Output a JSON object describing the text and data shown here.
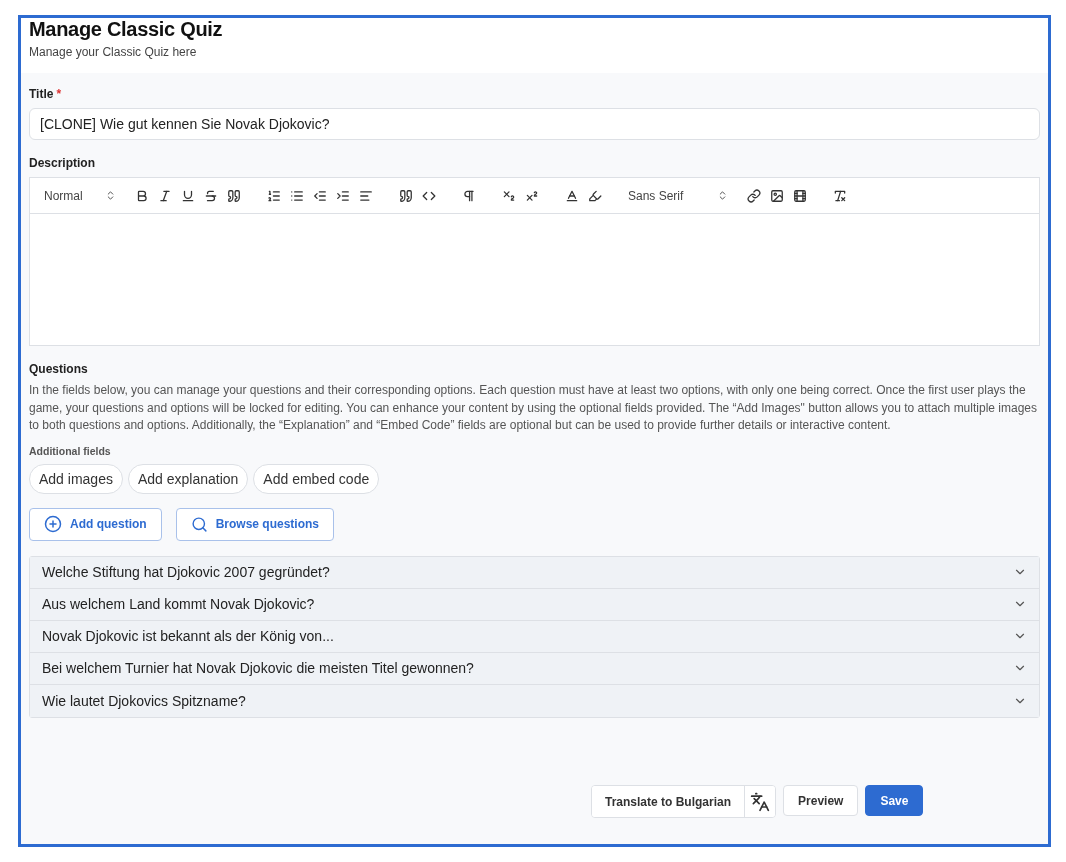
{
  "header": {
    "title": "Manage Classic Quiz",
    "subtitle": "Manage your Classic Quiz here"
  },
  "title_field": {
    "label": "Title",
    "required_mark": "*",
    "value": "[CLONE] Wie gut kennen Sie Novak Djokovic?"
  },
  "description": {
    "label": "Description",
    "toolbar": [
      {
        "kind": "select",
        "label": "Normal"
      },
      {
        "kind": "bold"
      },
      {
        "kind": "italic"
      },
      {
        "kind": "underline"
      },
      {
        "kind": "strike"
      },
      {
        "kind": "quote"
      },
      {
        "kind": "gap"
      },
      {
        "kind": "ordered"
      },
      {
        "kind": "bullet"
      },
      {
        "kind": "outdent"
      },
      {
        "kind": "indent"
      },
      {
        "kind": "align"
      },
      {
        "kind": "gap"
      },
      {
        "kind": "quote"
      },
      {
        "kind": "code"
      },
      {
        "kind": "gap"
      },
      {
        "kind": "pilcrow"
      },
      {
        "kind": "gap"
      },
      {
        "kind": "sub"
      },
      {
        "kind": "sup"
      },
      {
        "kind": "gap"
      },
      {
        "kind": "color"
      },
      {
        "kind": "background"
      },
      {
        "kind": "gap"
      },
      {
        "kind": "select",
        "label": "Sans Serif"
      },
      {
        "kind": "link"
      },
      {
        "kind": "image"
      },
      {
        "kind": "video"
      },
      {
        "kind": "gap"
      },
      {
        "kind": "clean"
      }
    ]
  },
  "questions": {
    "label": "Questions",
    "help": "In the fields below, you can manage your questions and their corresponding options. Each question must have at least two options, with only one being correct. Once the first user plays the game, your questions and options will be locked for editing. You can enhance your content by using the optional fields provided. The “Add Images\" button allows you to attach multiple images to both questions and options. Additionally, the “Explanation” and “Embed Code” fields are optional but can be used to provide further details or interactive content.",
    "additional_label": "Additional fields",
    "additional": [
      "Add images",
      "Add explanation",
      "Add embed code"
    ],
    "actions": [
      {
        "kind": "add",
        "label": "Add question"
      },
      {
        "kind": "browse",
        "label": "Browse questions"
      }
    ],
    "items": [
      {
        "text": "Welche Stiftung hat Djokovic 2007 gegründet?",
        "expanded": false
      },
      {
        "text": "Aus welchem Land kommt Novak Djokovic?",
        "expanded": false
      },
      {
        "text": "Novak Djokovic ist bekannt als der König von...",
        "expanded": false
      },
      {
        "text": "Bei welchem Turnier hat Novak Djokovic die meisten Titel gewonnen?",
        "expanded": false
      },
      {
        "text": "Wie lautet Djokovics Spitzname?",
        "expanded": false
      }
    ]
  },
  "footer": {
    "translate": "Translate to Bulgarian",
    "preview": "Preview",
    "save": "Save"
  }
}
